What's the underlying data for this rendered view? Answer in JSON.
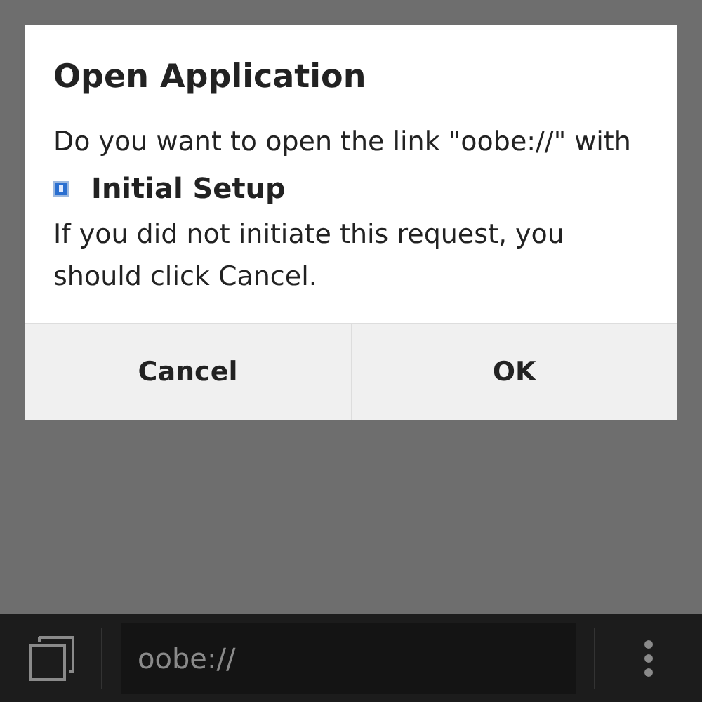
{
  "dialog": {
    "title": "Open Application",
    "message": "Do you want to open the link \"oobe://\" with",
    "app_name": "Initial Setup",
    "warning": "If you did not initiate this request, you should click Cancel.",
    "buttons": [
      "Cancel",
      "OK"
    ]
  },
  "browser_bar": {
    "address": "oobe://"
  }
}
